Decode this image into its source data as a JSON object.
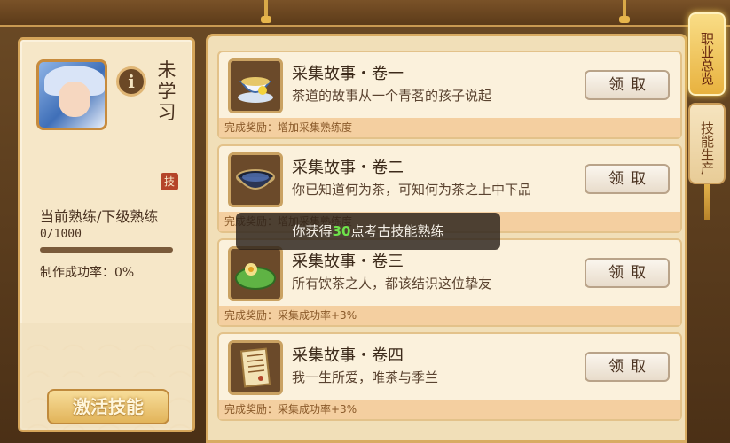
{
  "left_panel": {
    "status": "未学习",
    "seal_icon_text": "技",
    "proficiency_label": "当前熟练/下级熟练",
    "proficiency_value": "0/1000",
    "proficiency_fraction": 0,
    "success_rate": "制作成功率：0%",
    "activate_label": "激活技能"
  },
  "items": [
    {
      "title": "采集故事・卷一",
      "desc": "茶道的故事从一个青茗的孩子说起",
      "reward": "完成奖励：增加采集熟练度",
      "claim_label": "领取",
      "icon": "tea-cup-icon"
    },
    {
      "title": "采集故事・卷二",
      "desc": "你已知道何为茶，可知何为茶之上中下品",
      "reward": "完成奖励：增加采集熟练度",
      "claim_label": "领取",
      "icon": "tea-bowl-icon"
    },
    {
      "title": "采集故事・卷三",
      "desc": "所有饮茶之人，都该结识这位挚友",
      "reward": "完成奖励：采集成功率+3%",
      "claim_label": "领取",
      "icon": "lotus-leaf-icon"
    },
    {
      "title": "采集故事・卷四",
      "desc": "我一生所爱，唯茶与季兰",
      "reward": "完成奖励：采集成功率+3%",
      "claim_label": "领取",
      "icon": "scroll-letter-icon"
    }
  ],
  "toast": {
    "prefix": "你获得",
    "number": "30",
    "suffix": "点考古技能熟练"
  },
  "tabs": [
    {
      "label": "职业总览",
      "active": true
    },
    {
      "label": "技能生产",
      "active": false
    }
  ],
  "colors": {
    "accent_gold": "#e8b23f",
    "reward_strip": "#f4cfa0",
    "toast_number": "#6ee24a"
  }
}
